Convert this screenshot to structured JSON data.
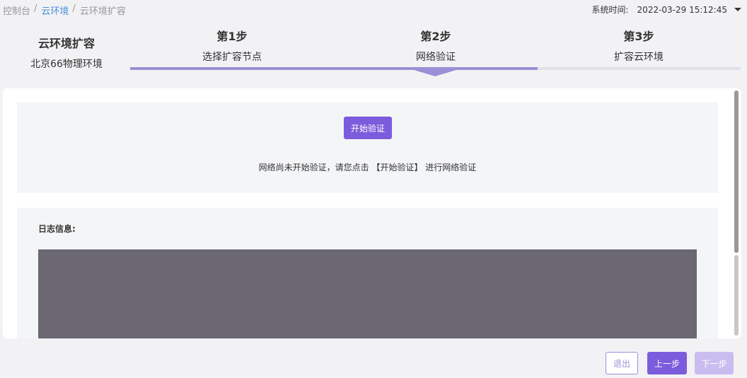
{
  "breadcrumb": {
    "items": [
      "控制台",
      "云环境",
      "云环境扩容"
    ],
    "separator": "/"
  },
  "system_time": {
    "label": "系统时间:",
    "value": "2022-03-29 15:12:45",
    "icon": "caret-down-icon"
  },
  "env": {
    "title": "云环境扩容",
    "name": "北京66物理环境"
  },
  "steps": [
    {
      "num": "第1步",
      "label": "选择扩容节点"
    },
    {
      "num": "第2步",
      "label": "网络验证"
    },
    {
      "num": "第3步",
      "label": "扩容云环境"
    }
  ],
  "progress": {
    "current_step": 2,
    "total_steps": 3,
    "fraction": 0.667
  },
  "verify": {
    "button_label": "开始验证",
    "hint": "网络尚未开始验证，请您点击 【开始验证】 进行网络验证"
  },
  "log": {
    "label": "日志信息:"
  },
  "footer": {
    "exit_label": "退出",
    "prev_label": "上一步",
    "next_label": "下一步"
  },
  "colors": {
    "accent": "#7b5cdc",
    "progress": "#9b8fd6",
    "disabled": "#c9bdf0",
    "link": "#4a90d9",
    "log_bg": "#6b6773"
  }
}
